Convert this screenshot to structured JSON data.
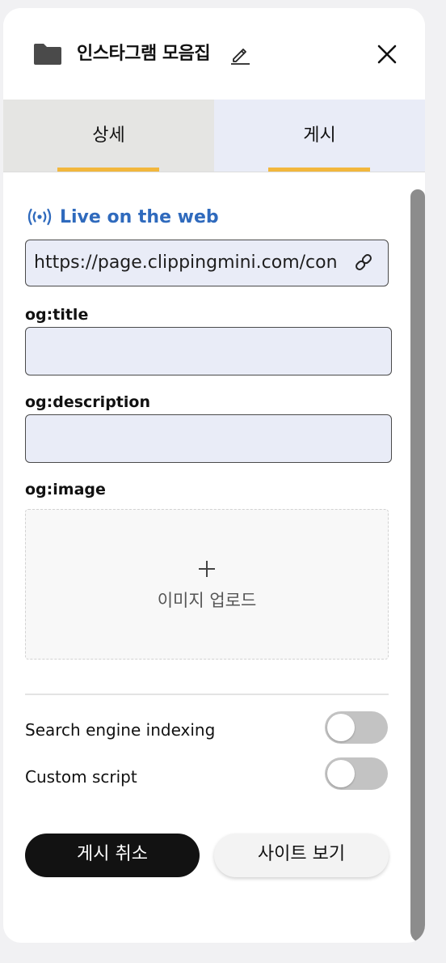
{
  "header": {
    "title": "인스타그램 모음집",
    "folder_icon": "folder-icon",
    "edit_icon": "pencil-icon",
    "close_icon": "close-icon"
  },
  "tabs": [
    {
      "label": "상세",
      "active": true
    },
    {
      "label": "게시",
      "active": false
    }
  ],
  "publish": {
    "status": "Live on the web",
    "status_icon": "broadcast-icon",
    "url": "https://page.clippingmini.com/con",
    "link_icon": "link-icon"
  },
  "fields": {
    "og_title": {
      "label": "og:title",
      "value": ""
    },
    "og_description": {
      "label": "og:description",
      "value": ""
    },
    "og_image": {
      "label": "og:image",
      "upload_label": "이미지 업로드"
    }
  },
  "settings": {
    "search_indexing": {
      "label": "Search engine indexing",
      "enabled": false
    },
    "custom_script": {
      "label": "Custom script",
      "enabled": false
    }
  },
  "buttons": {
    "unpublish": "게시 취소",
    "view_site": "사이트 보기"
  },
  "colors": {
    "accent_link": "#2f6abd",
    "tab_underline": "#f2b73d",
    "input_bg": "#e9ecf7"
  }
}
